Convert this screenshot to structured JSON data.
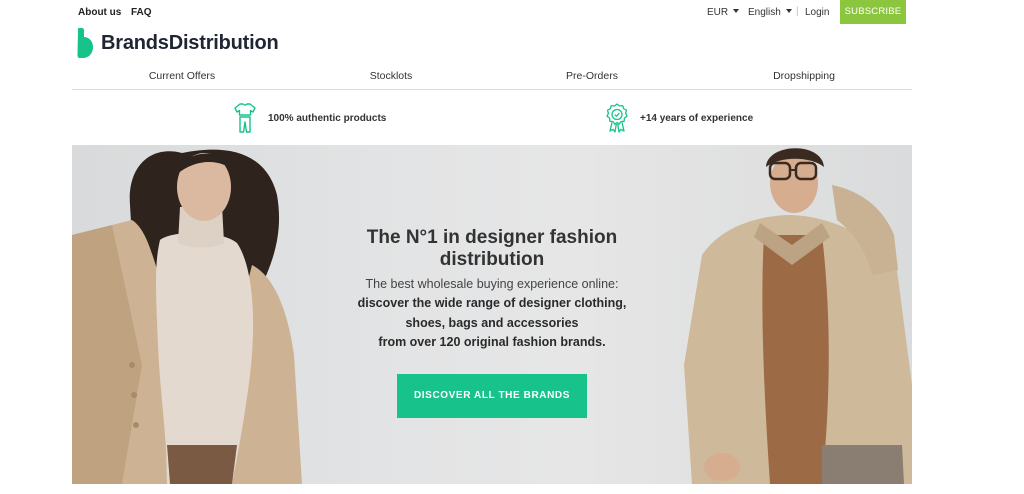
{
  "topbar": {
    "about_label": "About us",
    "faq_label": "FAQ",
    "currency": "EUR",
    "language": "English",
    "separator": "|",
    "login_label": "Login",
    "subscribe_label": "SUBSCRIBE"
  },
  "brand": {
    "name": "BrandsDistribution",
    "accent_color": "#17c38b",
    "subscribe_color": "#8cc63f"
  },
  "nav": {
    "items": [
      {
        "label": "Current Offers"
      },
      {
        "label": "Stocklots"
      },
      {
        "label": "Pre-Orders"
      },
      {
        "label": "Dropshipping"
      }
    ]
  },
  "features": [
    {
      "icon": "clothing-icon",
      "label": "100% authentic products"
    },
    {
      "icon": "award-ribbon-icon",
      "label": "+14 years of experience"
    }
  ],
  "hero": {
    "title": "The N°1 in designer fashion distribution",
    "line1": "The best wholesale buying experience online:",
    "line2": "discover the wide range of designer clothing,",
    "line3": "shoes, bags and accessories",
    "line4": "from over 120 original fashion brands.",
    "cta_label": "DISCOVER ALL THE BRANDS"
  }
}
